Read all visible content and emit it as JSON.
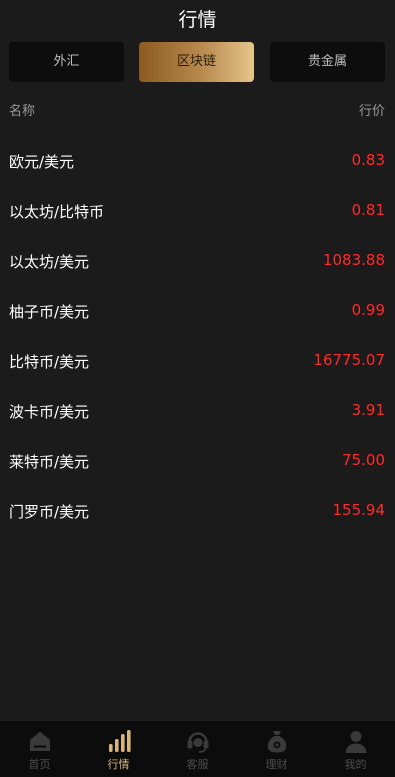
{
  "header": {
    "title": "行情"
  },
  "tabs": [
    {
      "label": "外汇"
    },
    {
      "label": "区块链"
    },
    {
      "label": "贵金属"
    }
  ],
  "columns": {
    "name": "名称",
    "price": "行价"
  },
  "rows": [
    {
      "name": "欧元/美元",
      "price": "0.83"
    },
    {
      "name": "以太坊/比特币",
      "price": "0.81"
    },
    {
      "name": "以太坊/美元",
      "price": "1083.88"
    },
    {
      "name": "柚子币/美元",
      "price": "0.99"
    },
    {
      "name": "比特币/美元",
      "price": "16775.07"
    },
    {
      "name": "波卡币/美元",
      "price": "3.91"
    },
    {
      "name": "莱特币/美元",
      "price": "75.00"
    },
    {
      "name": "门罗币/美元",
      "price": "155.94"
    }
  ],
  "nav": [
    {
      "label": "首页",
      "icon": "home-icon"
    },
    {
      "label": "行情",
      "icon": "bar-chart-icon"
    },
    {
      "label": "客服",
      "icon": "headset-icon"
    },
    {
      "label": "理财",
      "icon": "money-bag-icon"
    },
    {
      "label": "我的",
      "icon": "user-icon"
    }
  ],
  "colors": {
    "background": "#1b1b1b",
    "price": "#ff2a2a",
    "accent": "#d8b47a",
    "tab_active_start": "#8c5a20",
    "tab_active_end": "#e6c58b"
  }
}
